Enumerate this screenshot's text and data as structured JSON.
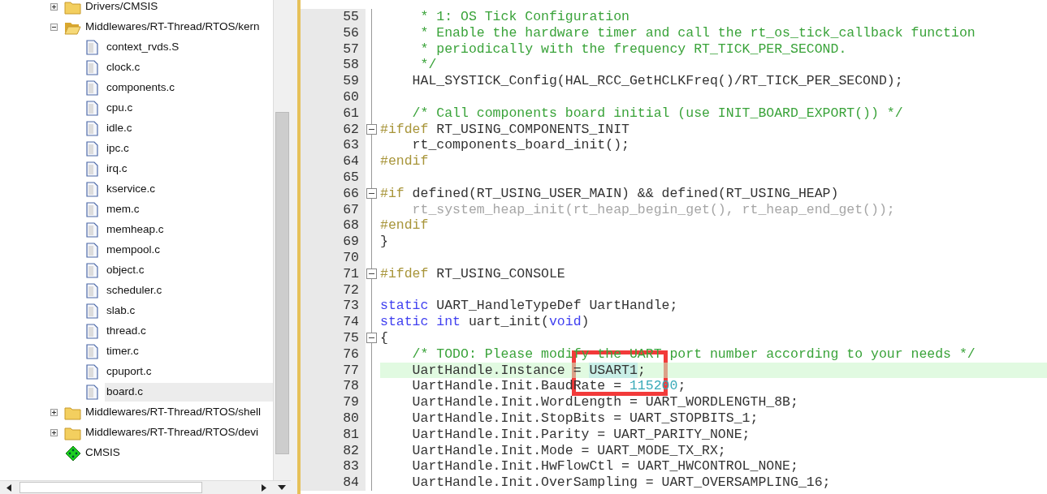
{
  "project_tree": [
    {
      "kind": "folder",
      "label": "Drivers/CMSIS",
      "expanded": false,
      "selected": false
    },
    {
      "kind": "folder",
      "label": "Middlewares/RT-Thread/RTOS/kern",
      "expanded": true,
      "selected": false,
      "children": [
        {
          "kind": "file",
          "label": "context_rvds.S",
          "selected": false
        },
        {
          "kind": "file",
          "label": "clock.c",
          "selected": false
        },
        {
          "kind": "file",
          "label": "components.c",
          "selected": false
        },
        {
          "kind": "file",
          "label": "cpu.c",
          "selected": false
        },
        {
          "kind": "file",
          "label": "idle.c",
          "selected": false
        },
        {
          "kind": "file",
          "label": "ipc.c",
          "selected": false
        },
        {
          "kind": "file",
          "label": "irq.c",
          "selected": false
        },
        {
          "kind": "file",
          "label": "kservice.c",
          "selected": false
        },
        {
          "kind": "file",
          "label": "mem.c",
          "selected": false
        },
        {
          "kind": "file",
          "label": "memheap.c",
          "selected": false
        },
        {
          "kind": "file",
          "label": "mempool.c",
          "selected": false
        },
        {
          "kind": "file",
          "label": "object.c",
          "selected": false
        },
        {
          "kind": "file",
          "label": "scheduler.c",
          "selected": false
        },
        {
          "kind": "file",
          "label": "slab.c",
          "selected": false
        },
        {
          "kind": "file",
          "label": "thread.c",
          "selected": false
        },
        {
          "kind": "file",
          "label": "timer.c",
          "selected": false
        },
        {
          "kind": "file",
          "label": "cpuport.c",
          "selected": false
        },
        {
          "kind": "file",
          "label": "board.c",
          "selected": true
        }
      ]
    },
    {
      "kind": "folder",
      "label": "Middlewares/RT-Thread/RTOS/shell",
      "expanded": false,
      "selected": false
    },
    {
      "kind": "folder",
      "label": "Middlewares/RT-Thread/RTOS/devi",
      "expanded": false,
      "selected": false
    },
    {
      "kind": "component",
      "label": "CMSIS",
      "selected": false
    }
  ],
  "editor": {
    "lines": [
      {
        "number": "55",
        "foldable": false,
        "current": false,
        "tokens": [
          {
            "kind": "comment",
            "text": "     * 1: OS Tick Configuration"
          }
        ]
      },
      {
        "number": "56",
        "foldable": false,
        "current": false,
        "tokens": [
          {
            "kind": "comment",
            "text": "     * Enable the hardware timer and call the rt_os_tick_callback function"
          }
        ]
      },
      {
        "number": "57",
        "foldable": false,
        "current": false,
        "tokens": [
          {
            "kind": "comment",
            "text": "     * periodically with the frequency RT_TICK_PER_SECOND."
          }
        ]
      },
      {
        "number": "58",
        "foldable": false,
        "current": false,
        "tokens": [
          {
            "kind": "comment",
            "text": "     */"
          }
        ]
      },
      {
        "number": "59",
        "foldable": false,
        "current": false,
        "tokens": [
          {
            "kind": "plain",
            "text": "    HAL_SYSTICK_Config(HAL_RCC_GetHCLKFreq()/RT_TICK_PER_SECOND);"
          }
        ]
      },
      {
        "number": "60",
        "foldable": false,
        "current": false
      },
      {
        "number": "61",
        "foldable": false,
        "current": false,
        "tokens": [
          {
            "kind": "comment",
            "text": "    /* Call components board initial (use INIT_BOARD_EXPORT()) */"
          }
        ]
      },
      {
        "number": "62",
        "foldable": true,
        "current": false,
        "tokens": [
          {
            "kind": "preproc",
            "text": "#ifdef"
          },
          {
            "kind": "plain",
            "text": " RT_USING_COMPONENTS_INIT"
          }
        ]
      },
      {
        "number": "63",
        "foldable": false,
        "current": false,
        "tokens": [
          {
            "kind": "plain",
            "text": "    rt_components_board_init();"
          }
        ]
      },
      {
        "number": "64",
        "foldable": false,
        "current": false,
        "tokens": [
          {
            "kind": "preproc",
            "text": "#endif"
          }
        ]
      },
      {
        "number": "65",
        "foldable": false,
        "current": false
      },
      {
        "number": "66",
        "foldable": true,
        "current": false,
        "tokens": [
          {
            "kind": "preproc",
            "text": "#if"
          },
          {
            "kind": "plain",
            "text": " defined(RT_USING_USER_MAIN) && defined(RT_USING_HEAP)"
          }
        ]
      },
      {
        "number": "67",
        "foldable": false,
        "current": false,
        "tokens": [
          {
            "kind": "inactive",
            "text": "    rt_system_heap_init(rt_heap_begin_get(), rt_heap_end_get());"
          }
        ]
      },
      {
        "number": "68",
        "foldable": false,
        "current": false,
        "tokens": [
          {
            "kind": "preproc",
            "text": "#endif"
          }
        ]
      },
      {
        "number": "69",
        "foldable": false,
        "current": false,
        "tokens": [
          {
            "kind": "plain",
            "text": "}"
          }
        ]
      },
      {
        "number": "70",
        "foldable": false,
        "current": false
      },
      {
        "number": "71",
        "foldable": true,
        "current": false,
        "tokens": [
          {
            "kind": "preproc",
            "text": "#ifdef"
          },
          {
            "kind": "plain",
            "text": " RT_USING_CONSOLE"
          }
        ]
      },
      {
        "number": "72",
        "foldable": false,
        "current": false
      },
      {
        "number": "73",
        "foldable": false,
        "current": false,
        "tokens": [
          {
            "kind": "keyword",
            "text": "static"
          },
          {
            "kind": "plain",
            "text": " UART_HandleTypeDef UartHandle;"
          }
        ]
      },
      {
        "number": "74",
        "foldable": false,
        "current": false,
        "tokens": [
          {
            "kind": "keyword",
            "text": "static int"
          },
          {
            "kind": "plain",
            "text": " uart_init("
          },
          {
            "kind": "keyword",
            "text": "void"
          },
          {
            "kind": "plain",
            "text": ")"
          }
        ]
      },
      {
        "number": "75",
        "foldable": true,
        "current": false,
        "tokens": [
          {
            "kind": "plain",
            "text": "{"
          }
        ]
      },
      {
        "number": "76",
        "foldable": false,
        "current": false,
        "tokens": [
          {
            "kind": "comment",
            "text": "    /* TODO: Please modify the UART port number according to your needs */"
          }
        ]
      },
      {
        "number": "77",
        "foldable": false,
        "current": true,
        "tokens": [
          {
            "kind": "plain",
            "text": "    UartHandle.Instance = "
          },
          {
            "kind": "match",
            "text": "USART1"
          },
          {
            "kind": "plain",
            "text": ";"
          }
        ]
      },
      {
        "number": "78",
        "foldable": false,
        "current": false,
        "tokens": [
          {
            "kind": "plain",
            "text": "    UartHandle.Init.BaudRate = "
          },
          {
            "kind": "number",
            "text": "115200"
          },
          {
            "kind": "plain",
            "text": ";"
          }
        ]
      },
      {
        "number": "79",
        "foldable": false,
        "current": false,
        "tokens": [
          {
            "kind": "plain",
            "text": "    UartHandle.Init.WordLength = UART_WORDLENGTH_8B;"
          }
        ]
      },
      {
        "number": "80",
        "foldable": false,
        "current": false,
        "tokens": [
          {
            "kind": "plain",
            "text": "    UartHandle.Init.StopBits = UART_STOPBITS_1;"
          }
        ]
      },
      {
        "number": "81",
        "foldable": false,
        "current": false,
        "tokens": [
          {
            "kind": "plain",
            "text": "    UartHandle.Init.Parity = UART_PARITY_NONE;"
          }
        ]
      },
      {
        "number": "82",
        "foldable": false,
        "current": false,
        "tokens": [
          {
            "kind": "plain",
            "text": "    UartHandle.Init.Mode = UART_MODE_TX_RX;"
          }
        ]
      },
      {
        "number": "83",
        "foldable": false,
        "current": false,
        "tokens": [
          {
            "kind": "plain",
            "text": "    UartHandle.Init.HwFlowCtl = UART_HWCONTROL_NONE;"
          }
        ]
      },
      {
        "number": "84",
        "foldable": false,
        "current": false,
        "tokens": [
          {
            "kind": "plain",
            "text": "    UartHandle.Init.OverSampling = UART_OVERSAMPLING_16;"
          }
        ]
      }
    ],
    "annotation_frame": true
  }
}
